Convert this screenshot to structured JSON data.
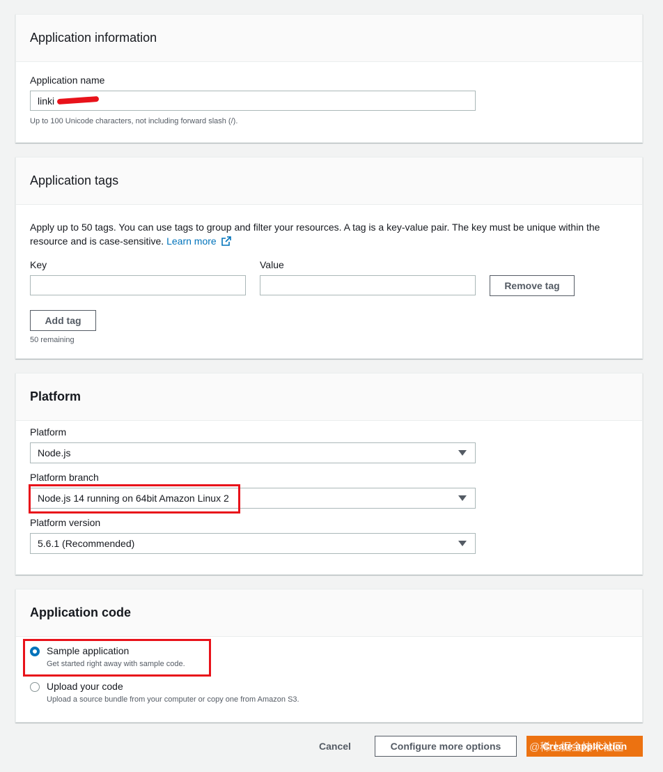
{
  "app_info": {
    "title": "Application information",
    "name_label": "Application name",
    "name_value": "linki",
    "name_hint": "Up to 100 Unicode characters, not including forward slash (/)."
  },
  "tags": {
    "title": "Application tags",
    "description": "Apply up to 50 tags. You can use tags to group and filter your resources. A tag is a key-value pair. The key must be unique within the resource and is case-sensitive.",
    "learn_more": "Learn more",
    "key_label": "Key",
    "value_label": "Value",
    "remove_tag": "Remove tag",
    "add_tag": "Add tag",
    "remaining": "50 remaining"
  },
  "platform": {
    "title": "Platform",
    "platform_label": "Platform",
    "platform_value": "Node.js",
    "branch_label": "Platform branch",
    "branch_value": "Node.js 14 running on 64bit Amazon Linux 2",
    "version_label": "Platform version",
    "version_value": "5.6.1 (Recommended)"
  },
  "code": {
    "title": "Application code",
    "options": [
      {
        "label": "Sample application",
        "description": "Get started right away with sample code.",
        "selected": true
      },
      {
        "label": "Upload your code",
        "description": "Upload a source bundle from your computer or copy one from Amazon S3.",
        "selected": false
      }
    ]
  },
  "footer": {
    "cancel": "Cancel",
    "configure": "Configure more options",
    "create": "Create application",
    "watermark": "@稀土掘金技术社区"
  },
  "colors": {
    "accent": "#0073bb",
    "primary_button": "#ec7211",
    "highlight": "#e8121a"
  }
}
